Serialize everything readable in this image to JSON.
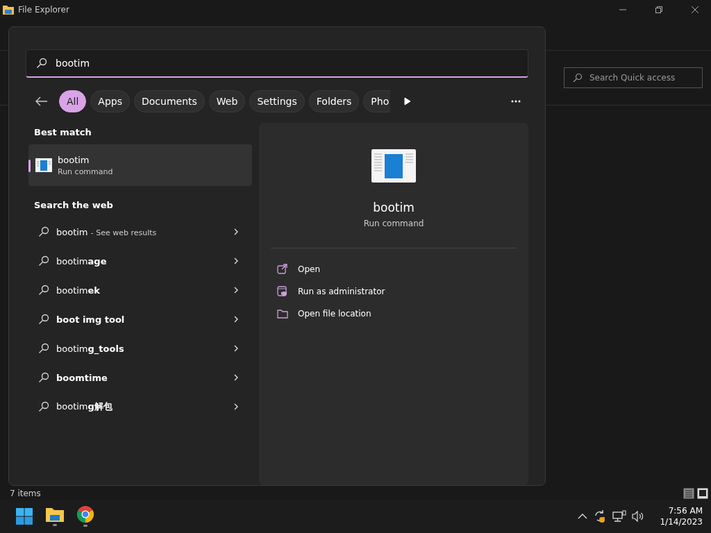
{
  "explorer": {
    "title": "File Explorer",
    "search": {
      "placeholder": "Search Quick access"
    },
    "status_bar": "7 items"
  },
  "search_panel": {
    "query": "bootim",
    "filters": [
      {
        "label": "All",
        "selected": true
      },
      {
        "label": "Apps",
        "selected": false
      },
      {
        "label": "Documents",
        "selected": false
      },
      {
        "label": "Web",
        "selected": false
      },
      {
        "label": "Settings",
        "selected": false
      },
      {
        "label": "Folders",
        "selected": false
      },
      {
        "label": "Pho",
        "selected": false
      }
    ],
    "best_match": {
      "heading": "Best match",
      "name": "bootim",
      "type": "Run command",
      "selected": true
    },
    "web": {
      "heading": "Search the web",
      "items": [
        {
          "text": "bootim",
          "suffix": "- See web results"
        },
        {
          "text": "bootim**age**"
        },
        {
          "text": "bootim**ek**"
        },
        {
          "text": "**boot img tool**"
        },
        {
          "text": "bootim**g_tools**"
        },
        {
          "text": "**boomtime**"
        },
        {
          "text": "bootim**g解包**"
        }
      ]
    },
    "preview": {
      "name": "bootim",
      "type": "Run command",
      "actions": [
        {
          "kind": "open",
          "label": "Open"
        },
        {
          "kind": "admin",
          "label": "Run as administrator"
        },
        {
          "kind": "folder",
          "label": "Open file location"
        }
      ]
    }
  },
  "taskbar": {
    "clock": {
      "time": "7:56 AM",
      "date": "1/14/2023"
    }
  }
}
